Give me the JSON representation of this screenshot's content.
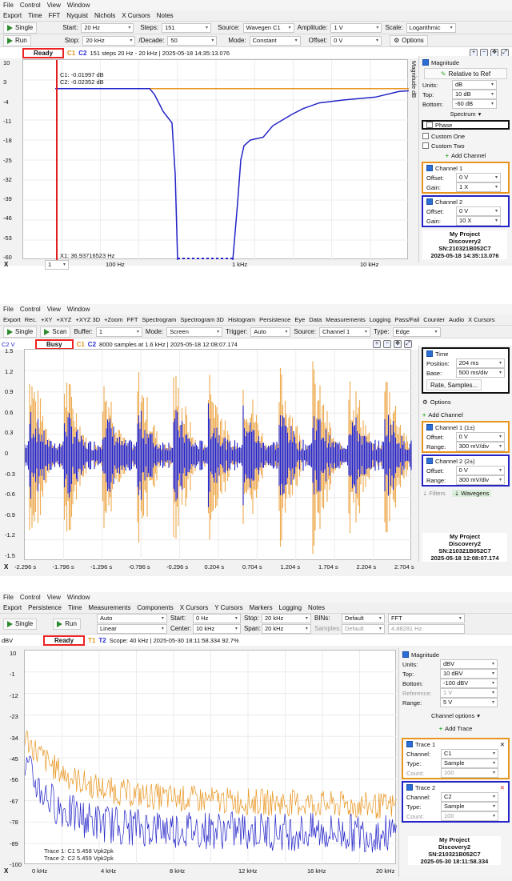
{
  "win1": {
    "menu": [
      "File",
      "Control",
      "View",
      "Window"
    ],
    "toolbar1": [
      "Export",
      "Time",
      "FFT",
      "Nyquist",
      "Nichols",
      "X Cursors",
      "Notes"
    ],
    "single_label": "Single",
    "run_label": "Run",
    "start_label": "Start:",
    "start_value": "20 Hz",
    "stop_label": "Stop:",
    "stop_value": "20 kHz",
    "steps_label": "Steps:",
    "steps_value": "151",
    "decade_label": "/Decade:",
    "decade_value": "50",
    "source_label": "Source:",
    "source_value": "Wavegen C1",
    "mode_label": "Mode:",
    "mode_value": "Constant",
    "amplitude_label": "Amplitude:",
    "amplitude_value": "1 V",
    "offset_label": "Offset:",
    "offset_value": "0 V",
    "scale_label": "Scale:",
    "scale_value": "Logarithmic",
    "options_label": "Options",
    "status": "Ready",
    "c1": "C1",
    "c2": "C2",
    "status_text": "151 steps  20 Hz - 20 kHz | 2025-05-18 14:35:13.076",
    "cursor_c1": "C1: -0.01997 dB",
    "cursor_c2": "C2: -0.02352 dB",
    "cursor_x1": "X1: 36.93716523 Hz",
    "yticks": [
      "10",
      "3",
      "-4",
      "-11",
      "-18",
      "-25",
      "-32",
      "-39",
      "-46",
      "-53",
      "-60"
    ],
    "xticks": [
      "100 Hz",
      "1 kHz",
      "10 kHz"
    ],
    "x_label": "X",
    "x_index": "1",
    "side_axis": "Magnitude  dB",
    "panel": {
      "magnitude": "Magnitude",
      "relative": "Relative to Ref",
      "units_label": "Units:",
      "units_value": "dB",
      "top_label": "Top:",
      "top_value": "10 dB",
      "bottom_label": "Bottom:",
      "bottom_value": "-60 dB",
      "spectrum": "Spectrum",
      "phase": "Phase",
      "custom_one": "Custom One",
      "custom_two": "Custom Two",
      "add_channel": "Add Channel",
      "ch1": "Channel 1",
      "ch1_offset": "0 V",
      "ch1_gain": "1 X",
      "ch2": "Channel 2",
      "ch2_offset": "0 V",
      "ch2_gain": "10 X",
      "offset_label": "Offset:",
      "gain_label": "Gain:"
    },
    "info": [
      "My Project",
      "Discovery2",
      "SN:210321B052C7",
      "2025-05-18 14:35:13.076"
    ]
  },
  "win2": {
    "menu": [
      "File",
      "Control",
      "View",
      "Window"
    ],
    "toolbar1": [
      "Export",
      "Rec.",
      "+XY",
      "+XYZ",
      "+XYZ 3D",
      "+Zoom",
      "FFT",
      "Spectrogram",
      "Spectrogram 3D",
      "Histogram",
      "Persistence",
      "Eye",
      "Data",
      "Measurements",
      "Logging",
      "Pass/Fail",
      "Counter",
      "Audio",
      "X Cursors"
    ],
    "single_label": "Single",
    "scan_label": "Scan",
    "buffer_label": "Buffer:",
    "buffer_value": "1",
    "mode_label": "Mode:",
    "mode_value": "Screen",
    "trigger_label": "Trigger:",
    "trigger_value": "Auto",
    "source_label": "Source:",
    "source_value": "Channel 1",
    "type_label": "Type:",
    "type_value": "Edge",
    "y_unit": "C2 V",
    "status": "Busy",
    "c1": "C1",
    "c2": "C2",
    "status_text": "8000 samples at 1.6 kHz | 2025-05-18 12:08:07.174",
    "yticks": [
      "1.5",
      "1.2",
      "0.9",
      "0.6",
      "0.3",
      "0",
      "-0.3",
      "-0.6",
      "-0.9",
      "-1.2",
      "-1.5"
    ],
    "xticks": [
      "-2.296 s",
      "-1.796 s",
      "-1.296 s",
      "-0.796 s",
      "-0.296 s",
      "0.204 s",
      "0.704 s",
      "1.204 s",
      "1.704 s",
      "2.204 s",
      "2.704 s"
    ],
    "x_label": "X",
    "panel": {
      "time": "Time",
      "position_label": "Position:",
      "position_value": "204 ms",
      "base_label": "Base:",
      "base_value": "500 ms/div",
      "rate": "Rate, Samples...",
      "options": "Options",
      "add_channel": "Add Channel",
      "ch1": "Channel 1 (1±)",
      "ch1_offset": "0 V",
      "ch1_range": "300 mV/div",
      "ch2": "Channel 2 (2±)",
      "ch2_offset": "0 V",
      "ch2_range": "300 mV/div",
      "offset_label": "Offset:",
      "range_label": "Range:",
      "filters": "Filters",
      "wavegens": "Wavegens"
    },
    "info": [
      "My Project",
      "Discovery2",
      "SN:210321B052C7",
      "2025-05-18 12:08:07.174"
    ]
  },
  "win3": {
    "menu": [
      "File",
      "Control",
      "View",
      "Window"
    ],
    "toolbar1": [
      "Export",
      "Persistence",
      "Time",
      "Measurements",
      "Components",
      "X Cursors",
      "Y Cursors",
      "Markers",
      "Logging",
      "Notes"
    ],
    "single_label": "Single",
    "run_label": "Run",
    "mode1_value": "Auto",
    "mode2_value": "Linear",
    "start_label": "Start:",
    "start_value": "0 Hz",
    "center_label": "Center:",
    "center_value": "10 kHz",
    "stop_label": "Stop:",
    "stop_value": "20 kHz",
    "span_label": "Span:",
    "span_value": "20 kHz",
    "bins_label": "BINs:",
    "bins_value": "Default",
    "samples_label": "Samples:",
    "samples_value": "Default",
    "fft_value": "FFT",
    "resolution_value": "4.88281 Hz",
    "y_unit": "dBV",
    "status": "Ready",
    "t1": "T1",
    "t2": "T2",
    "status_text": "Scope: 40 kHz | 2025-05-30 18:11:58.334 92.7%",
    "trace_note1": "Trace 1: C1 5.458 Vpk2pk",
    "trace_note2": "Trace 2: C2 5.459 Vpk2pk",
    "yticks": [
      "10",
      "-1",
      "-12",
      "-23",
      "-34",
      "-45",
      "-56",
      "-67",
      "-78",
      "-89",
      "-100"
    ],
    "xticks": [
      "0 kHz",
      "4 kHz",
      "8 kHz",
      "12 kHz",
      "16 kHz",
      "20 kHz"
    ],
    "x_label": "X",
    "panel": {
      "magnitude": "Magnitude",
      "units_label": "Units:",
      "units_value": "dBV",
      "top_label": "Top:",
      "top_value": "10 dBV",
      "bottom_label": "Bottom:",
      "bottom_value": "-100 dBV",
      "reference_label": "Reference:",
      "reference_value": "1 V",
      "range_label": "Range:",
      "range_value": "5 V",
      "channel_options": "Channel options",
      "add_trace": "Add Trace",
      "tr1": "Trace 1",
      "tr1_channel": "C1",
      "tr1_type": "Sample",
      "tr1_count": "100",
      "tr2": "Trace 2",
      "tr2_channel": "C2",
      "tr2_type": "Sample",
      "tr2_count": "100",
      "channel_label": "Channel:",
      "type_label": "Type:",
      "count_label": "Count:"
    },
    "info": [
      "My Project",
      "Discovery2",
      "SN:210321B052C7",
      "2025-05-30 18:11:58.334"
    ]
  },
  "colors": {
    "c1": "#e8951f",
    "c2": "#2323c8",
    "cursor": "#e02020",
    "accent": "#2b6fd6"
  }
}
